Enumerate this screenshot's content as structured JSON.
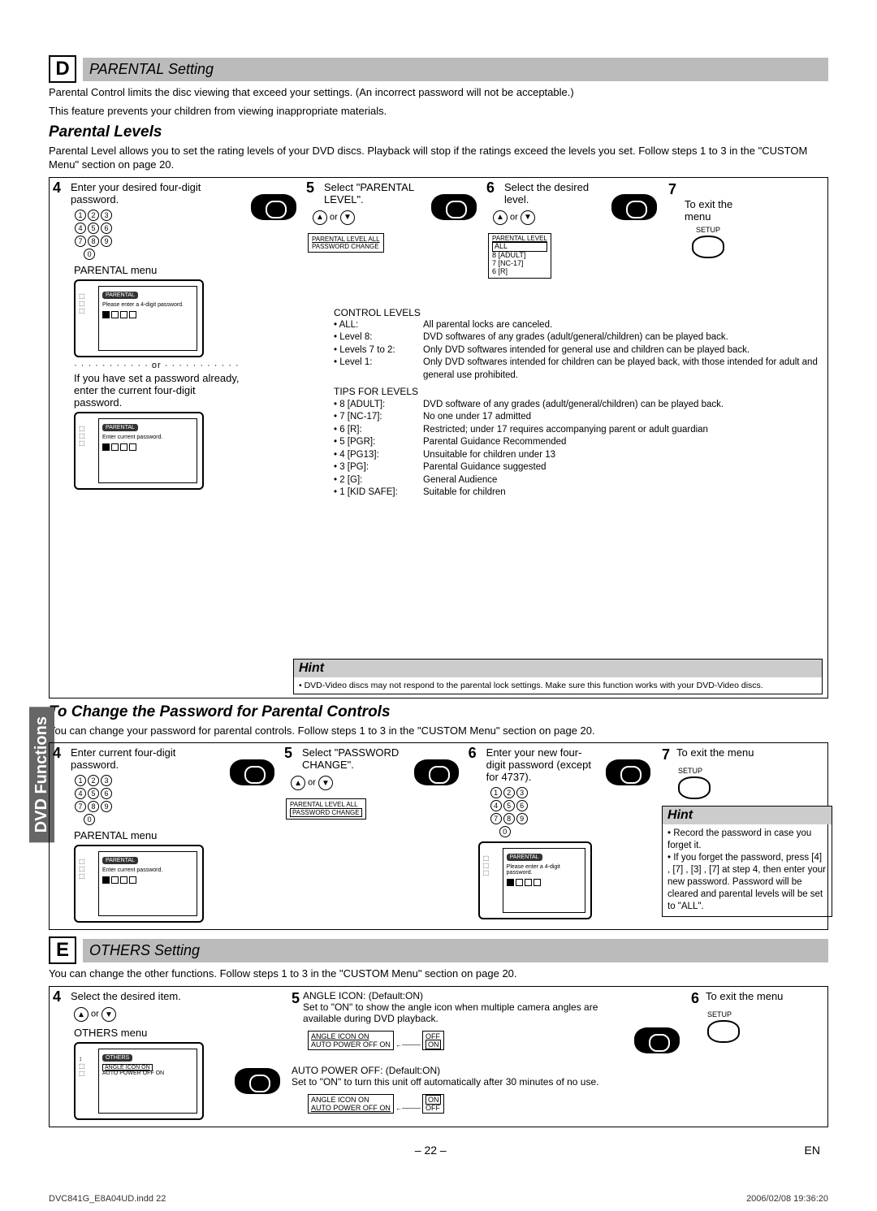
{
  "side_tab": "DVD Functions",
  "sectionD": {
    "letter": "D",
    "title": "PARENTAL Setting",
    "intro1": "Parental Control limits the disc viewing that exceed your settings. (An incorrect password will not be acceptable.)",
    "intro2": "This feature prevents your children from viewing inappropriate materials.",
    "sub1": "Parental Levels",
    "sub1desc": "Parental Level allows you to set the rating levels of your DVD discs. Playback will stop if the ratings exceed the levels you set. Follow steps 1 to 3 in the \"CUSTOM Menu\" section on page 20.",
    "step4a": "Enter your desired four-digit password.",
    "menu_label": "PARENTAL menu",
    "osd1_title": "PARENTAL",
    "osd1_line": "Please enter a 4-digit password.",
    "or_sep": "or",
    "step4b": "If you have set a password already, enter the current four-digit password.",
    "osd2_line": "Enter current password.",
    "step5": "Select \"PARENTAL LEVEL\".",
    "menu5_r1": "PARENTAL LEVEL   ALL",
    "menu5_r2": "PASSWORD CHANGE",
    "step6": "Select the desired level.",
    "menu6_hdr": "PARENTAL LEVEL",
    "menu6_r1": "ALL",
    "menu6_r2": "8 [ADULT]",
    "menu6_r3": "7 [NC-17]",
    "menu6_r4": "6 [R]",
    "step7": "To exit the menu",
    "setup_label": "SETUP",
    "control_hdr": "CONTROL LEVELS",
    "cl": [
      [
        "• ALL:",
        "All parental locks are canceled."
      ],
      [
        "• Level 8:",
        "DVD softwares of any grades (adult/general/children) can be played back."
      ],
      [
        "• Levels 7 to 2:",
        "Only DVD softwares intended for general use and children can be played back."
      ],
      [
        "• Level 1:",
        "Only DVD softwares intended for children can be played back, with those intended for adult and general use prohibited."
      ]
    ],
    "tips_hdr": "TIPS FOR LEVELS",
    "tl": [
      [
        "• 8 [ADULT]:",
        "DVD software of any grades (adult/general/children) can be played back."
      ],
      [
        "• 7 [NC-17]:",
        "No one under 17 admitted"
      ],
      [
        "• 6 [R]:",
        "Restricted; under 17 requires accompanying parent or adult guardian"
      ],
      [
        "• 5 [PGR]:",
        "Parental Guidance Recommended"
      ],
      [
        "• 4 [PG13]:",
        "Unsuitable for children under 13"
      ],
      [
        "• 3 [PG]:",
        "Parental Guidance suggested"
      ],
      [
        "• 2 [G]:",
        "General Audience"
      ],
      [
        "• 1 [KID SAFE]:",
        "Suitable for children"
      ]
    ],
    "hint": "Hint",
    "hint_body": "• DVD-Video discs may not respond to the parental lock settings. Make sure this function works with your DVD-Video discs.",
    "sub2": "To Change the Password for Parental Controls",
    "sub2desc": "You can change your password for parental controls. Follow steps 1 to 3 in the \"CUSTOM Menu\" section on page 20.",
    "p4": "Enter current four-digit password.",
    "p5": "Select \"PASSWORD CHANGE\".",
    "p5_r1": "PARENTAL LEVEL   ALL",
    "p5_r2": "PASSWORD CHANGE",
    "p6": "Enter your new four-digit password (except for 4737).",
    "p7": "To exit the menu",
    "hint2a": "• Record the password in case you forget it.",
    "hint2b": "• If you forget the password, press [4] , [7] , [3] , [7]  at step 4, then enter your new password. Password will be cleared and parental levels will be set to \"ALL\"."
  },
  "sectionE": {
    "letter": "E",
    "title": "OTHERS Setting",
    "intro": "You can change the other functions. Follow steps 1 to 3 in the \"CUSTOM Menu\" section on page 20.",
    "step4": "Select the desired item.",
    "menu_label": "OTHERS menu",
    "osd_title": "OTHERS",
    "osd_r1": "ANGLE ICON     ON",
    "osd_r2": "AUTO POWER OFF ON",
    "step5a_h": "ANGLE ICON:  (Default:ON)",
    "step5a_d": "Set to \"ON\" to show the angle icon when multiple camera angles are available during DVD playback.",
    "step5a_r1": "ANGLE ICON      ON",
    "step5a_r2": "AUTO POWER OFF  ON",
    "step5a_opt1": "OFF",
    "step5a_opt2": "ON",
    "step5b_h": "AUTO POWER OFF:  (Default:ON)",
    "step5b_d": "Set to \"ON\" to turn this unit off automatically after 30 minutes of no use.",
    "step5b_r1": "ANGLE ICON      ON",
    "step5b_r2": "AUTO POWER OFF  ON",
    "step5b_opt1": "ON",
    "step5b_opt2": "OFF",
    "step6": "To exit the menu"
  },
  "footer": {
    "page": "– 22 –",
    "lang": "EN"
  },
  "print": {
    "file": "DVC841G_E8A04UD.indd   22",
    "time": "2006/02/08   19:36:20"
  }
}
